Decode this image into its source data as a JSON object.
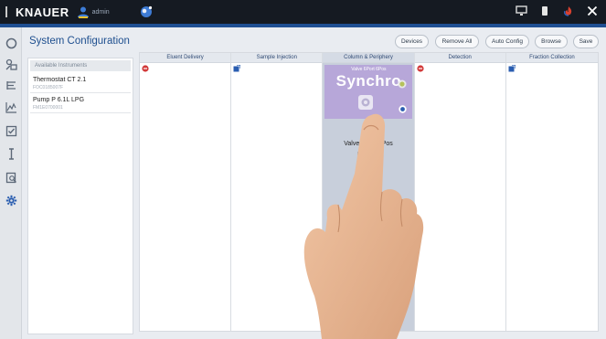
{
  "titlebar": {
    "brand": "KNAUER",
    "user_label": "admin",
    "icons": [
      "user-icon",
      "planet-icon",
      "monitor-icon",
      "device-icon",
      "flame-icon",
      "close-icon"
    ]
  },
  "sidebar": {
    "icons": [
      "circle-icon",
      "devices-icon",
      "method-icon",
      "chart-icon",
      "check-icon",
      "cursor-icon",
      "report-icon",
      "gear-icon"
    ]
  },
  "page": {
    "title": "System Configuration"
  },
  "toolbar": {
    "devices": "Devices",
    "remove_all": "Remove All",
    "auto_config": "Auto Config",
    "browse": "Browse",
    "save": "Save"
  },
  "instruments": {
    "header": "Available Instruments",
    "items": [
      {
        "name": "Thermostat CT 2.1",
        "sub": "FOC0185007F"
      },
      {
        "name": "Pump P 6.1L LPG",
        "sub": "FM1E0700001"
      }
    ]
  },
  "columns": [
    {
      "title": "Eluent Delivery"
    },
    {
      "title": "Sample Injection"
    },
    {
      "title": "Column & Periphery"
    },
    {
      "title": "Detection"
    },
    {
      "title": "Fraction Collection"
    }
  ],
  "device_card": {
    "title": "Valve 6Port 6Pos",
    "brand": "Synchro"
  },
  "valve": {
    "label": "Valve 6Port 6Pos",
    "sub": "FW1E0...N"
  },
  "colors": {
    "titlebar": "#151a22",
    "accent": "#1e4f8f",
    "card": "#b7a7d9",
    "active_column": "#c8cfdb",
    "remove": "#d23a3a",
    "add": "#2a5db0"
  }
}
